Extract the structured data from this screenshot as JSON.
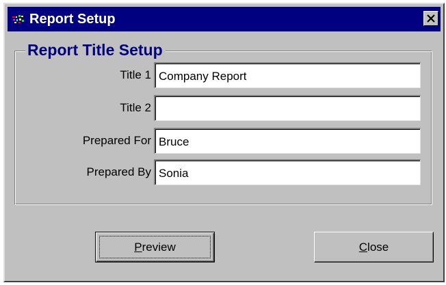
{
  "window": {
    "title": "Report Setup",
    "close_glyph": "✕",
    "icon": "app-icon",
    "titlebar_color": "#000080",
    "face_color": "#c0c0c0"
  },
  "group": {
    "title": "Report Title Setup",
    "title_color": "#000080"
  },
  "fields": [
    {
      "label": "Title 1",
      "value": "Company Report"
    },
    {
      "label": "Title 2",
      "value": ""
    },
    {
      "label": "Prepared For",
      "value": "Bruce"
    },
    {
      "label": "Prepared By",
      "value": "Sonia"
    }
  ],
  "buttons": {
    "preview": {
      "accel": "P",
      "rest": "review"
    },
    "close": {
      "accel": "C",
      "rest": "lose"
    }
  }
}
